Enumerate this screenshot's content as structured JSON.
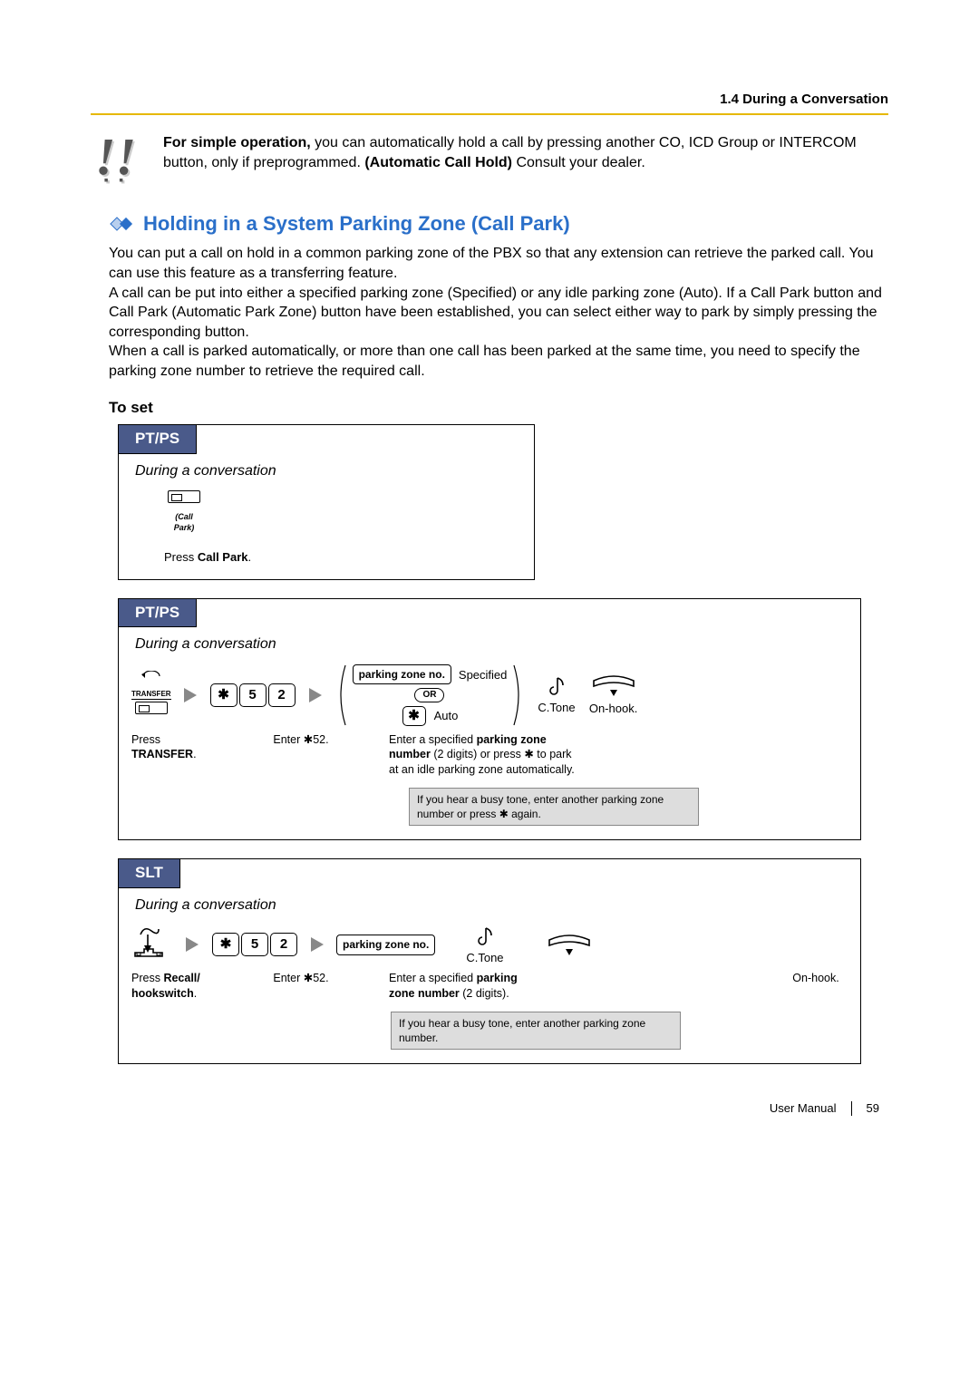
{
  "header": {
    "section": "1.4 During a Conversation"
  },
  "intro": {
    "lead_bold": "For simple operation,",
    "lead_rest": " you can automatically hold a call by pressing another CO, ICD Group or INTERCOM button, only if preprogrammed. ",
    "auto_hold_bold": "(Automatic Call Hold)",
    "tail": " Consult your dealer."
  },
  "title": "Holding in a System Parking Zone (Call Park)",
  "desc": "You can put a call on hold in a common parking zone of the PBX so that any extension can retrieve the parked call. You can use this feature as a transferring feature.\nA call can be put into either a specified parking zone (Specified) or any idle parking zone (Auto). If a Call Park button and Call Park (Automatic Park Zone) button have been established, you can select either way to park by simply pressing the corresponding button.\nWhen a call is parked automatically, or more than one call has been parked at the same time, you need to specify the parking zone number to retrieve the required call.",
  "toset": "To set",
  "panels": {
    "ptps1": {
      "tab": "PT/PS",
      "context": "During a conversation",
      "btn_label": "(Call Park)",
      "caption_prefix": "Press ",
      "caption_bold": "Call Park",
      "caption_suffix": "."
    },
    "ptps2": {
      "tab": "PT/PS",
      "context": "During a conversation",
      "transfer_label": "TRANSFER",
      "step1_prefix": "Press ",
      "step1_bold": "TRANSFER",
      "step1_suffix": ".",
      "keys": [
        "✱",
        "5",
        "2"
      ],
      "step2": "Enter ✱52.",
      "pzn_label": "parking zone no.",
      "specified": "Specified",
      "or": "OR",
      "auto": "Auto",
      "step3_line1_a": "Enter a specified ",
      "step3_line1_b": "parking zone number",
      "step3_line1_c": " (2 digits) or press ✱ to park at an idle parking zone automatically.",
      "ctone": "C.Tone",
      "onhook": "On-hook.",
      "busy": "If you hear a busy tone, enter another parking zone number or press ✱ again."
    },
    "slt": {
      "tab": "SLT",
      "context": "During a conversation",
      "step1_prefix": "Press ",
      "step1_bold": "Recall/\nhookswitch",
      "step1_suffix": ".",
      "keys": [
        "✱",
        "5",
        "2"
      ],
      "step2": "Enter ✱52.",
      "pzn_label": "parking zone no.",
      "step3_a": "Enter a specified ",
      "step3_b": "parking zone number",
      "step3_c": " (2 digits).",
      "ctone": "C.Tone",
      "onhook": "On-hook.",
      "busy": "If you hear a busy tone, enter another parking zone number."
    }
  },
  "footer": {
    "manual": "User Manual",
    "page": "59"
  }
}
